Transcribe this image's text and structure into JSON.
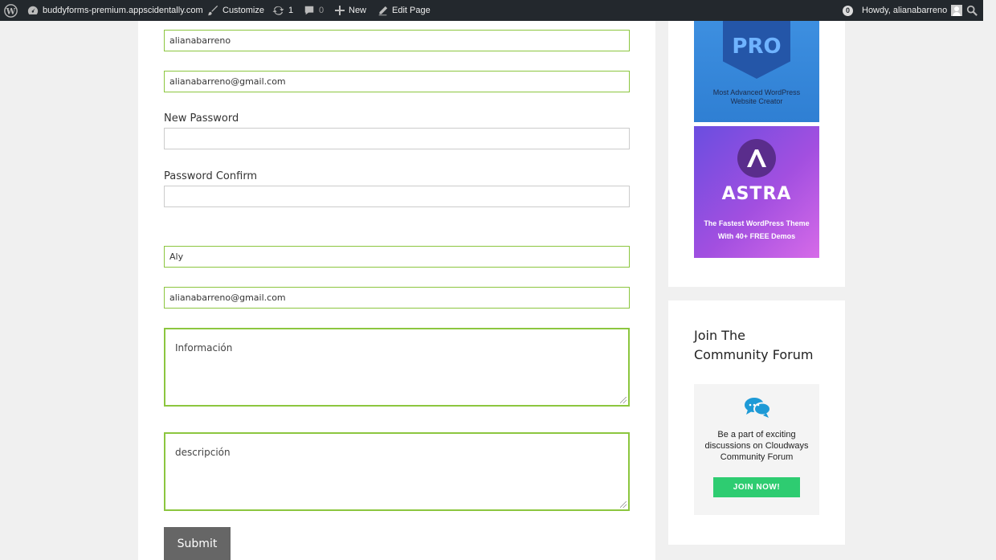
{
  "adminbar": {
    "site_name": "buddyforms-premium.appscidentally.com",
    "customize_label": "Customize",
    "updates_count": "1",
    "comments_count": "0",
    "new_label": "New",
    "edit_page_label": "Edit Page",
    "notification_count": "0",
    "howdy_label": "Howdy, alianabarreno"
  },
  "form": {
    "username_value": "alianabarreno",
    "email_value": "alianabarreno@gmail.com",
    "new_password_label": "New Password",
    "new_password_value": "",
    "password_confirm_label": "Password Confirm",
    "password_confirm_value": "",
    "name_value": "Aly",
    "email2_value": "alianabarreno@gmail.com",
    "info_placeholder": "Información",
    "description_placeholder": "descripción",
    "submit_label": "Submit"
  },
  "sidebar": {
    "pro_ad": {
      "logo_text": "PRO",
      "line1": "Most Advanced WordPress",
      "line2": "Website Creator"
    },
    "astra_ad": {
      "word": "ASTRA",
      "line1": "The Fastest WordPress Theme",
      "line2": "With 40+ FREE Demos"
    },
    "community_widget": {
      "title": "Join The Community Forum",
      "line1": "Be a part of exciting",
      "line2": "discussions on Cloudways",
      "line3": "Community Forum",
      "button_label": "JOIN NOW!"
    }
  },
  "colors": {
    "adminbar_bg": "#23282d",
    "field_border": "#8cc63f",
    "submit_bg": "#666666",
    "join_button": "#2ecc71"
  }
}
